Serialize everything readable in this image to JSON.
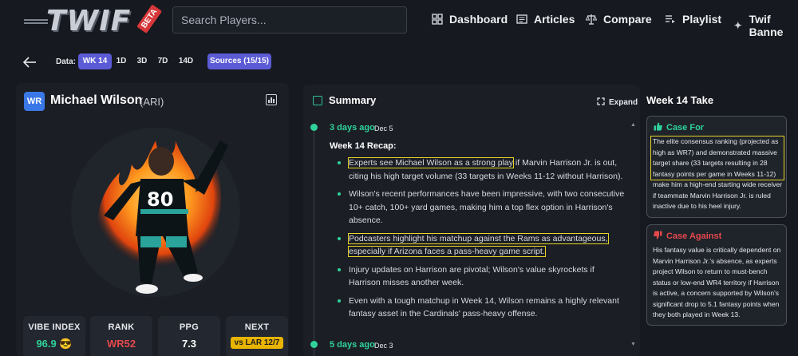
{
  "brand": {
    "logo_text": "TWIF",
    "badge": "BETA"
  },
  "search": {
    "placeholder": "Search Players..."
  },
  "nav": [
    {
      "label": "Dashboard",
      "icon": "grid-icon"
    },
    {
      "label": "Articles",
      "icon": "newspaper-icon"
    },
    {
      "label": "Compare",
      "icon": "scale-icon"
    },
    {
      "label": "Playlist",
      "icon": "playlist-icon"
    },
    {
      "label": "Twif Banne",
      "icon": "sparkle-icon"
    }
  ],
  "data_row": {
    "label": "Data:",
    "options": [
      "WK 14",
      "1D",
      "3D",
      "7D",
      "14D"
    ],
    "selected": "WK 14",
    "sources": "Sources (15/15)"
  },
  "player": {
    "position": "WR",
    "name": "Michael Wilson",
    "team": "(ARI)",
    "jersey": "80"
  },
  "stats": [
    {
      "label": "VIBE INDEX",
      "value": "96.9",
      "emoji": "😎",
      "color": "#2fd39a"
    },
    {
      "label": "RANK",
      "value": "WR52",
      "color": "#e5484d"
    },
    {
      "label": "PPG",
      "value": "7.3",
      "color": "#ffffff"
    },
    {
      "label": "NEXT",
      "value": "vs LAR 12/7",
      "color": "#1a1a1a"
    }
  ],
  "summary": {
    "title": "Summary",
    "expand_label": "Expand",
    "entries": [
      {
        "ago": "3 days ago",
        "date": "Dec 5",
        "recap_title": "Week 14 Recap:",
        "bullets": [
          {
            "hl": "Experts see Michael Wilson as a strong play",
            "rest": " if Marvin Harrison Jr. is out, citing his high target volume (33 targets in Weeks 11-12 without Harrison)."
          },
          {
            "hl": "",
            "rest": "Wilson's recent performances have been impressive, with two consecutive 10+ catch, 100+ yard games, making him a top flex option in Harrison's absence."
          },
          {
            "hl": "Podcasters highlight his matchup against the Rams as advantageous, especially if Arizona faces a pass-heavy game script.",
            "rest": ""
          },
          {
            "hl": "",
            "rest": "Injury updates on Harrison are pivotal; Wilson's value skyrockets if Harrison misses another week."
          },
          {
            "hl": "",
            "rest": "Even with a tough matchup in Week 14, Wilson remains a highly relevant fantasy asset in the Cardinals' pass-heavy offense."
          }
        ]
      },
      {
        "ago": "5 days ago",
        "date": "Dec 3"
      }
    ]
  },
  "take": {
    "title": "Week 14 Take",
    "case_for": {
      "title": "Case For",
      "highlight": "The elite consensus ranking (projected as high as WR7) and demonstrated massive target share (33 targets resulting in 28 fantasy points per game in Weeks 11-12)",
      "rest": "make him a high-end starting wide receiver if teammate Marvin Harrison Jr. is ruled inactive due to his heel injury."
    },
    "case_against": {
      "title": "Case Against",
      "text": "His fantasy value is critically dependent on Marvin Harrison Jr.'s absence, as experts project Wilson to return to must-bench status or low-end WR4 territory if Harrison is active, a concern supported by Wilson's significant drop to 5.1 fantasy points when they both played in Week 13."
    }
  },
  "colors": {
    "accent": "#5b5bd6",
    "green": "#2fd39a",
    "red": "#e5484d",
    "gold": "#e8b400"
  }
}
